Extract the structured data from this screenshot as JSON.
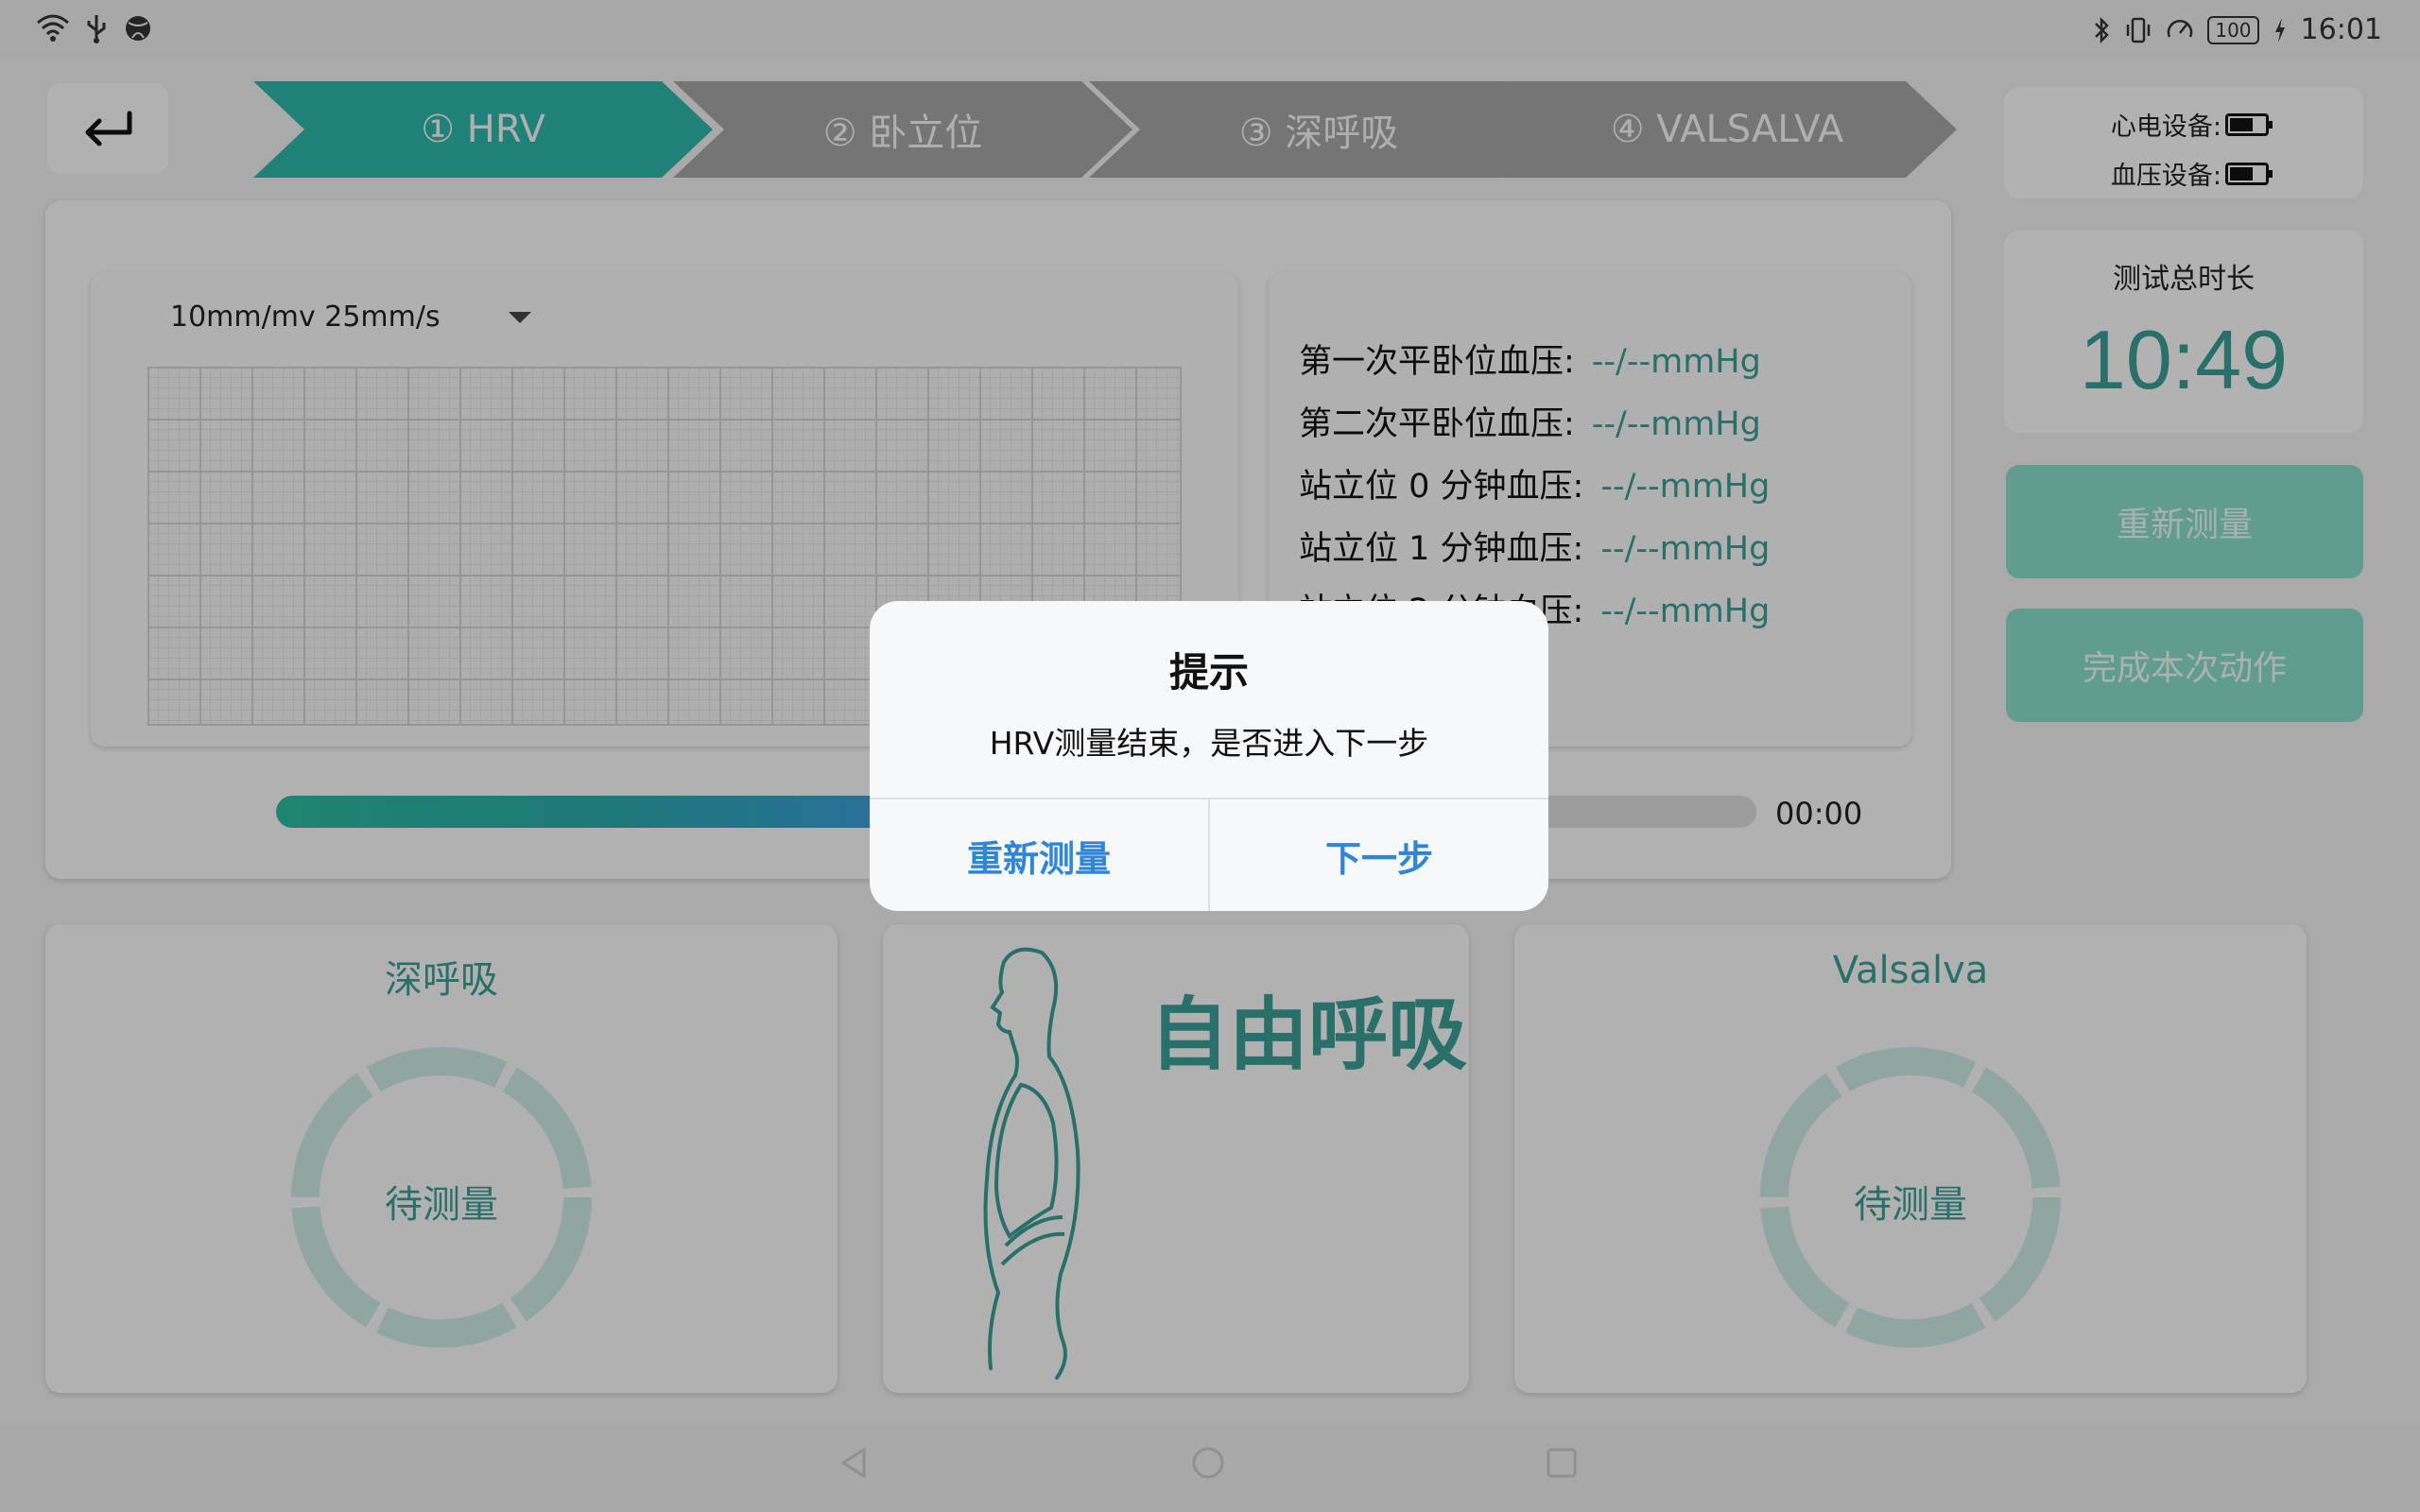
{
  "status_bar": {
    "left_icons": [
      "wifi-icon",
      "usb-icon",
      "globe-icon"
    ],
    "right_icons": [
      "bluetooth-icon",
      "vibrate-icon",
      "speed-icon"
    ],
    "battery": "100",
    "time": "16:01"
  },
  "steps": [
    {
      "label": "① HRV",
      "active": true
    },
    {
      "label": "② 卧立位",
      "active": false
    },
    {
      "label": "③ 深呼吸",
      "active": false
    },
    {
      "label": "④ VALSALVA",
      "active": false
    }
  ],
  "devices": {
    "ecg_label": "心电设备:",
    "bp_label": "血压设备:"
  },
  "timer": {
    "label": "测试总时长",
    "value": "10:49"
  },
  "side_buttons": {
    "remeasure": "重新测量",
    "finish": "完成本次动作"
  },
  "ecg": {
    "scale": "10mm/mv 25mm/s"
  },
  "bp": [
    {
      "label": "第一次平卧位血压:",
      "value": "--/--mmHg"
    },
    {
      "label": "第二次平卧位血压:",
      "value": "--/--mmHg"
    },
    {
      "label": "站立位 0 分钟血压:",
      "value": "--/--mmHg"
    },
    {
      "label": "站立位 1 分钟血压:",
      "value": "--/--mmHg"
    },
    {
      "label": "站立位 2 分钟血压:",
      "value": "--/--mmHg"
    }
  ],
  "progress": {
    "fraction": 0.42,
    "time": "00:00"
  },
  "cards": {
    "deep_breath": {
      "title": "深呼吸",
      "status": "待测量"
    },
    "free_breath": {
      "title": "自由呼吸"
    },
    "valsalva": {
      "title": "Valsalva",
      "status": "待测量"
    }
  },
  "dialog": {
    "title": "提示",
    "message": "HRV测量结束，是否进入下一步",
    "cancel": "重新测量",
    "confirm": "下一步"
  },
  "colors": {
    "accent": "#3a9a93",
    "step_inactive": "#a3a3a3",
    "dialog_button": "#2f86d6"
  }
}
